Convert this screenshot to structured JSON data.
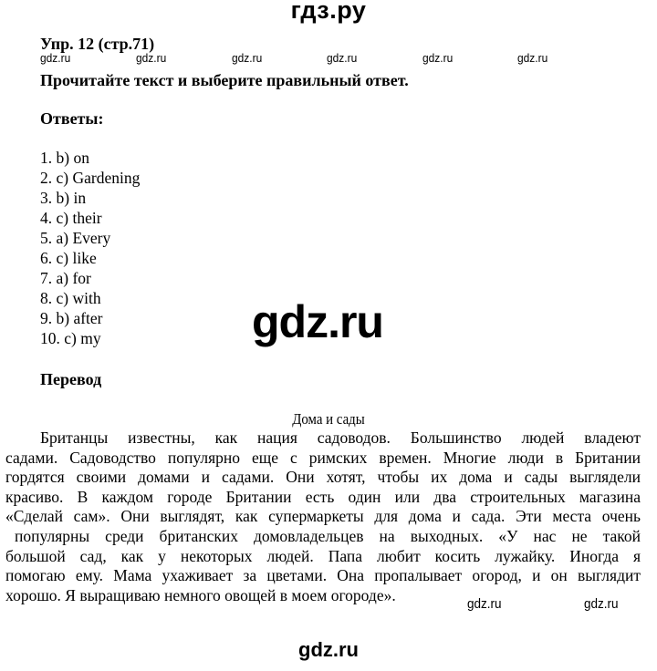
{
  "header": {
    "site_title": "гдз.ру"
  },
  "exercise": {
    "title": "Упр. 12 (стр.71)",
    "task": "Прочитайте текст и выберите правильный ответ."
  },
  "watermarks": {
    "row": [
      "gdz.ru",
      "gdz.ru",
      "gdz.ru",
      "gdz.ru",
      "gdz.ru",
      "gdz.ru"
    ],
    "big": "gdz.ru",
    "inline": [
      "gdz.ru",
      "gdz.ru"
    ],
    "footer": "gdz.ru"
  },
  "answers": {
    "heading": "Ответы:",
    "items": [
      "1. b) on",
      "2. c) Gardening",
      "3. b) in",
      "4. c) their",
      "5. a) Every",
      "6. c) like",
      "7. a) for",
      "8. c) with",
      "9. b) after",
      "10. c) my"
    ]
  },
  "translation": {
    "heading": "Перевод",
    "story_title": "Дома и сады",
    "lines": [
      "Британцы известны, как нация садоводов. Большинство людей владеют",
      "садами. Садоводство популярно еще с римских времен. Многие люди в Британии",
      "гордятся своими домами и садами. Они хотят, чтобы их дома и сады выглядели",
      "красиво. В каждом городе Британии есть один или два строительных магазина",
      "«Сделай сам». Они выглядят, как супермаркеты для дома и сада. Эти места очень",
      "популярны среди британских домовладельцев на выходных. «У нас не такой",
      "большой сад, как у некоторых людей. Папа любит косить лужайку. Иногда я",
      "помогаю ему. Мама ухаживает за цветами. Она пропалывает огород, и он выглядит",
      "хорошо. Я выращиваю немного овощей в моем огороде»."
    ]
  }
}
